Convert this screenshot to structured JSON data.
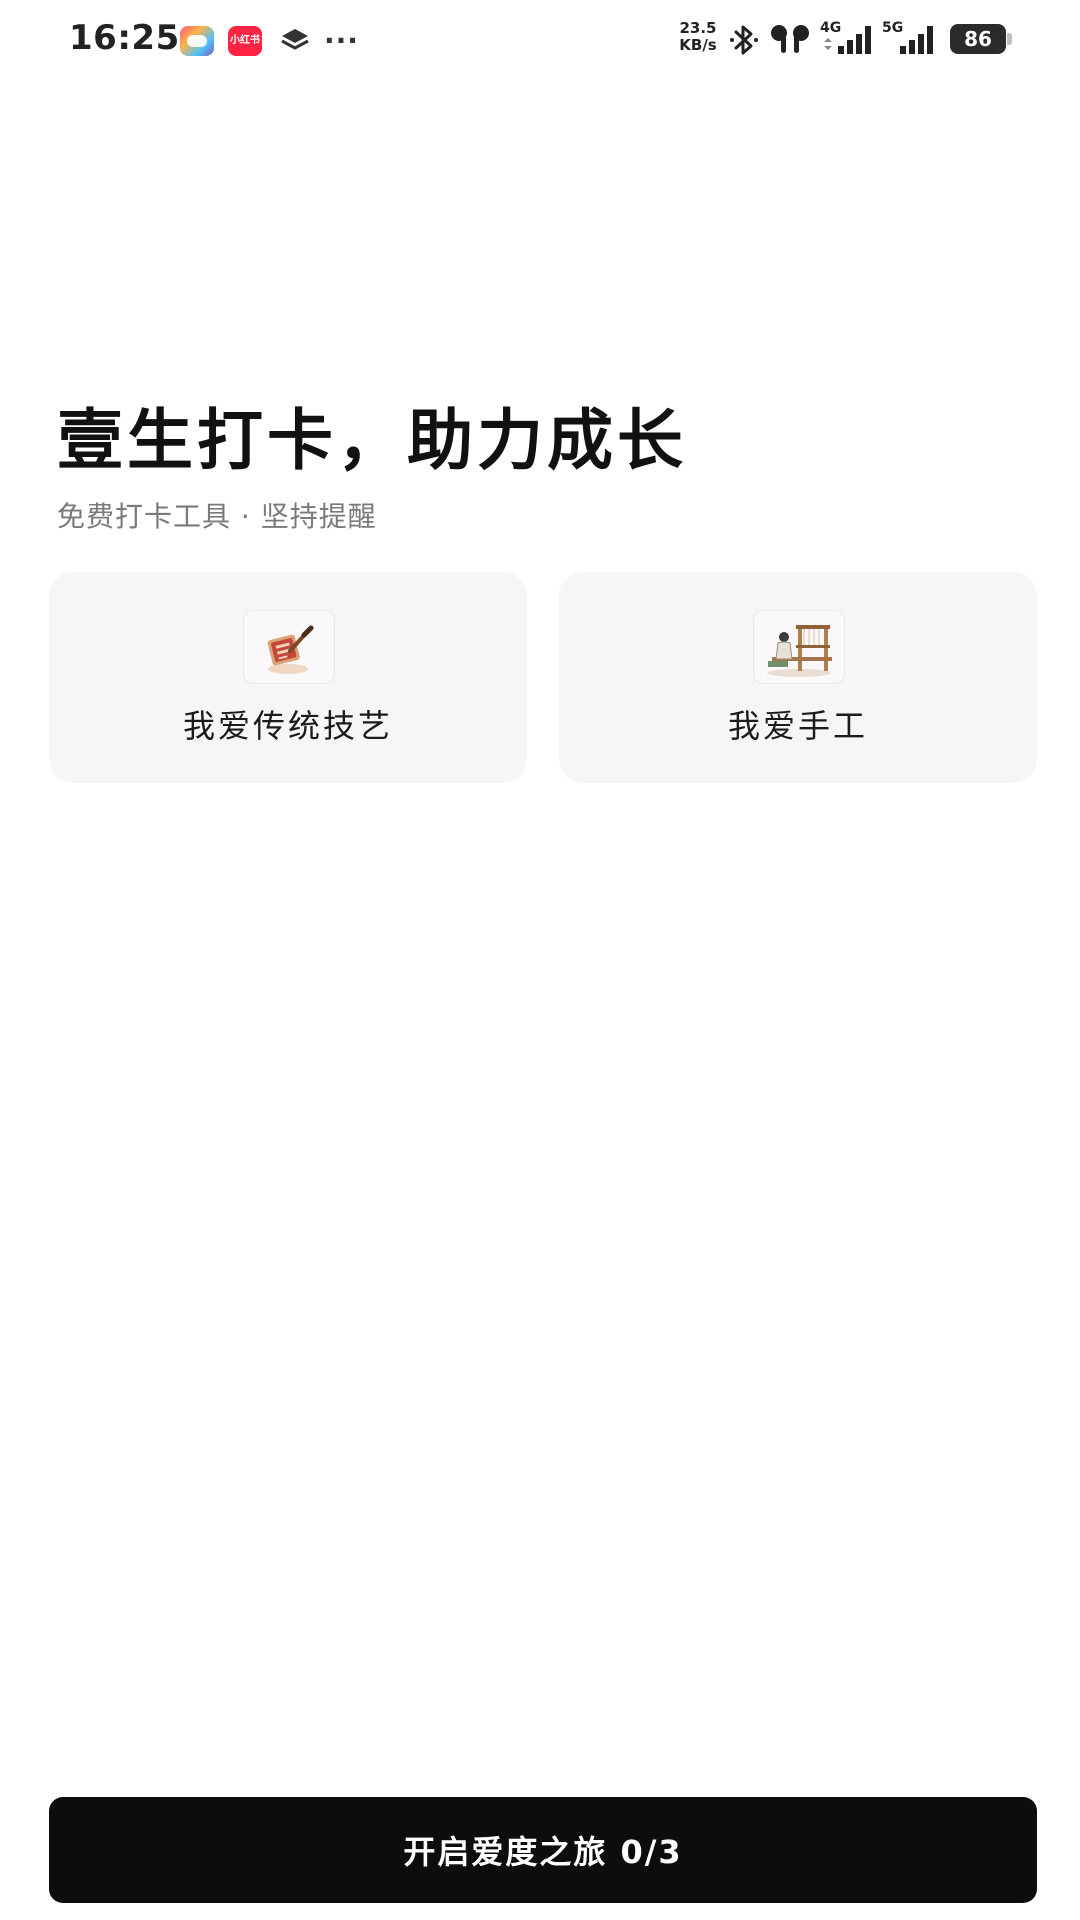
{
  "status_bar": {
    "time": "16:25",
    "xhs_icon_text": "小红书",
    "more_text": "···",
    "net_speed_value": "23.5",
    "net_speed_unit": "KB/s",
    "net_label_1": "4G",
    "net_label_2": "5G",
    "battery_level": "86",
    "icons": [
      "game-center-icon",
      "xiaohongshu-app-icon",
      "layers-icon",
      "more-dots-icon",
      "bluetooth-icon",
      "earbuds-icon",
      "signal-4g-icon",
      "signal-5g-icon",
      "battery-icon"
    ]
  },
  "header": {
    "title": "壹生打卡，助力成长",
    "subtitle": "免费打卡工具 · 坚持提醒"
  },
  "categories": [
    {
      "label": "我爱传统技艺",
      "icon": "carving-tool-icon"
    },
    {
      "label": "我爱手工",
      "icon": "loom-icon"
    }
  ],
  "footer": {
    "start_button_label": "开启爱度之旅 0/3",
    "selected_count": 0,
    "required_count": 3
  },
  "colors": {
    "background": "#ffffff",
    "card_background": "#f7f6f7",
    "button_background": "#0d0d0d",
    "button_text": "#ffffff",
    "subtitle_text": "#7a7a7a",
    "brand_red": "#ff2442"
  }
}
